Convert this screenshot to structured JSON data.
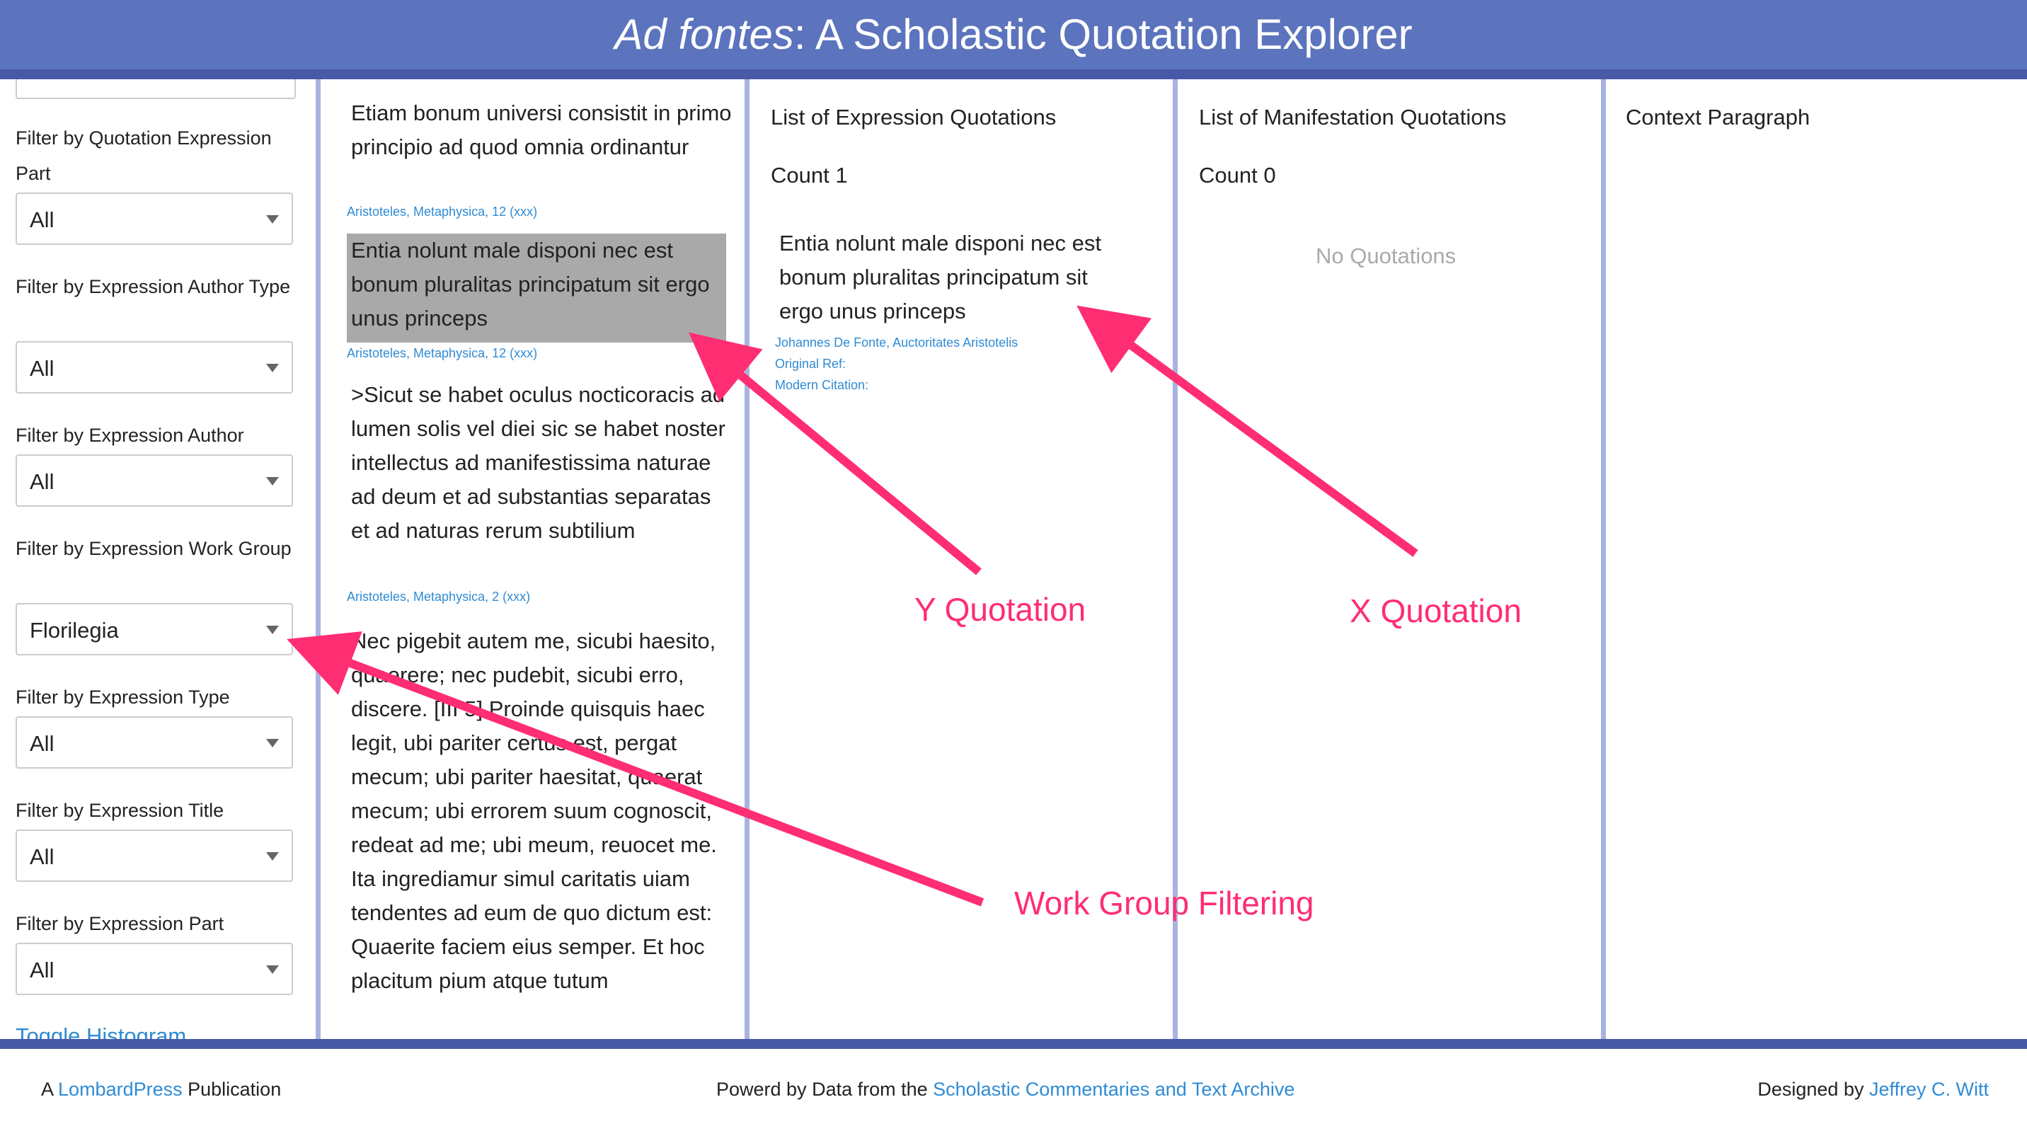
{
  "header": {
    "title_italic": "Ad fontes",
    "title_rest": ": A Scholastic Quotation Explorer"
  },
  "sidebar": {
    "filters": [
      {
        "label": "Filter by Quotation Expression Part",
        "value": "All"
      },
      {
        "label": "Filter by Expression Author Type",
        "value": "All"
      },
      {
        "label": "Filter by Expression Author",
        "value": "All"
      },
      {
        "label": "Filter by Expression Work Group",
        "value": "Florilegia"
      },
      {
        "label": "Filter by Expression Type",
        "value": "All"
      },
      {
        "label": "Filter by Expression Title",
        "value": "All"
      },
      {
        "label": "Filter by Expression Part",
        "value": "All"
      }
    ],
    "toggle_histogram": "Toggle Histogram"
  },
  "quotes": [
    {
      "text": "Etiam bonum universi consistit in primo principio ad quod omnia ordinantur",
      "cite": "Aristoteles, Metaphysica, 12 (xxx)"
    },
    {
      "text": "Entia nolunt male disponi nec est bonum pluralitas principatum sit ergo unus princeps",
      "cite": "Aristoteles, Metaphysica, 12 (xxx)"
    },
    {
      "text": ">Sicut se habet oculus nocticoracis ad lumen solis vel diei sic se habet noster intellectus ad manifestissima naturae ad deum et ad substantias separatas et ad naturas rerum subtilium",
      "cite": "Aristoteles, Metaphysica, 2 (xxx)"
    },
    {
      "text": "Nec pigebit autem me, sicubi haesito, quaerere; nec pudebit, sicubi erro, discere. [III 5] Proinde quisquis haec legit, ubi pariter certus est, pergat mecum; ubi pariter haesitat, quaerat mecum; ubi errorem suum cognoscit, redeat ad me; ubi meum, reuocet me. Ita ingrediamur simul caritatis uiam tendentes ad eum de quo dictum est: Quaerite faciem eius semper. Et hoc placitum pium atque tutum",
      "cite": ""
    }
  ],
  "expression_col": {
    "title": "List of Expression Quotations",
    "count": "Count 1",
    "item_text": "Entia nolunt male disponi nec est bonum pluralitas principatum sit ergo unus princeps",
    "item_cite": "Johannes De Fonte, Auctoritates Aristotelis",
    "original_ref": "Original Ref:",
    "modern_citation": "Modern Citation:"
  },
  "manifestation_col": {
    "title": "List of Manifestation Quotations",
    "count": "Count 0",
    "empty": "No Quotations"
  },
  "context_col": {
    "title": "Context Paragraph"
  },
  "annotations": {
    "y": "Y Quotation",
    "x": "X Quotation",
    "wg": "Work Group Filtering"
  },
  "footer": {
    "left_a": "A ",
    "left_link": "LombardPress",
    "left_b": " Publication",
    "mid_a": "Powerd by Data from the ",
    "mid_link": "Scholastic Commentaries and Text Archive",
    "right_a": "Designed by ",
    "right_link": "Jeffrey C. Witt"
  },
  "colors": {
    "header": "#5c73bd",
    "header_bar": "#4759a7",
    "separator": "#a8b4df",
    "link": "#2f8bd4",
    "highlight": "#a9a9a9",
    "annotation": "#ff2d72"
  }
}
